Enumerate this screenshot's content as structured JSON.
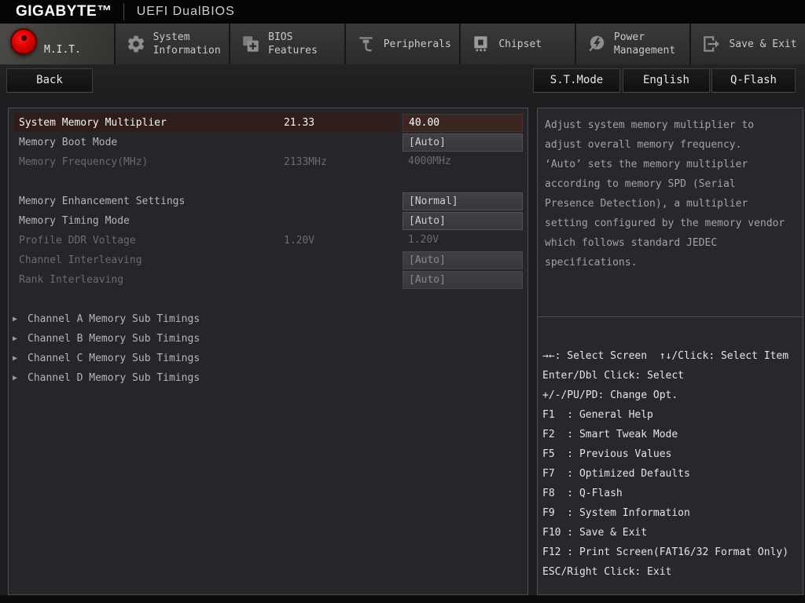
{
  "header": {
    "brand": "GIGABYTE™",
    "title": "UEFI DualBIOS"
  },
  "tabs": [
    {
      "label": "M.I.T.",
      "selected": true
    },
    {
      "label": "System Information",
      "selected": false
    },
    {
      "label": "BIOS Features",
      "selected": false
    },
    {
      "label": "Peripherals",
      "selected": false
    },
    {
      "label": "Chipset",
      "selected": false
    },
    {
      "label": "Power Management",
      "selected": false
    },
    {
      "label": "Save & Exit",
      "selected": false
    }
  ],
  "toolbar": {
    "back": "Back",
    "st_mode": "S.T.Mode",
    "language": "English",
    "qflash": "Q-Flash"
  },
  "settings": {
    "rows": [
      {
        "label": "System Memory Multiplier",
        "current": "21.33",
        "value": "40.00",
        "state": "selected"
      },
      {
        "label": "Memory Boot Mode",
        "current": "",
        "value": "[Auto]",
        "state": "normal"
      },
      {
        "label": "Memory Frequency(MHz)",
        "current": "2133MHz",
        "value": "4000MHz",
        "state": "disabled"
      },
      {
        "label": "Memory Enhancement Settings",
        "current": "",
        "value": "[Normal]",
        "state": "normal"
      },
      {
        "label": "Memory Timing Mode",
        "current": "",
        "value": "[Auto]",
        "state": "normal"
      },
      {
        "label": "Profile DDR Voltage",
        "current": "1.20V",
        "value": "1.20V",
        "state": "disabled"
      },
      {
        "label": "Channel Interleaving",
        "current": "",
        "value": "[Auto]",
        "state": "disabled"
      },
      {
        "label": "Rank Interleaving",
        "current": "",
        "value": "[Auto]",
        "state": "disabled"
      },
      {
        "label": "Channel A Memory Sub Timings",
        "submenu": true
      },
      {
        "label": "Channel B Memory Sub Timings",
        "submenu": true
      },
      {
        "label": "Channel C Memory Sub Timings",
        "submenu": true
      },
      {
        "label": "Channel D Memory Sub Timings",
        "submenu": true
      }
    ],
    "submenu_arrow": "▶"
  },
  "help": {
    "lines": [
      "Adjust system memory multiplier to",
      "adjust overall memory frequency.",
      "‘Auto’ sets the memory multiplier",
      "according to memory SPD (Serial",
      "Presence Detection), a multiplier",
      "setting configured by the memory vendor",
      "which follows standard JEDEC",
      "specifications."
    ]
  },
  "shortcuts": [
    "→←: Select Screen  ↑↓/Click: Select Item",
    "Enter/Dbl Click: Select",
    "+/-/PU/PD: Change Opt.",
    "F1  : General Help",
    "F2  : Smart Tweak Mode",
    "F5  : Previous Values",
    "F7  : Optimized Defaults",
    "F8  : Q-Flash",
    "F9  : System Information",
    "F10 : Save & Exit",
    "F12 : Print Screen(FAT16/32 Format Only)",
    "ESC/Right Click: Exit"
  ],
  "colors": {
    "accent_red": "#d90000",
    "highlight_row": "#2e1d19",
    "highlight_value_box": "#3b2621",
    "panel_bg": "#26262a"
  }
}
